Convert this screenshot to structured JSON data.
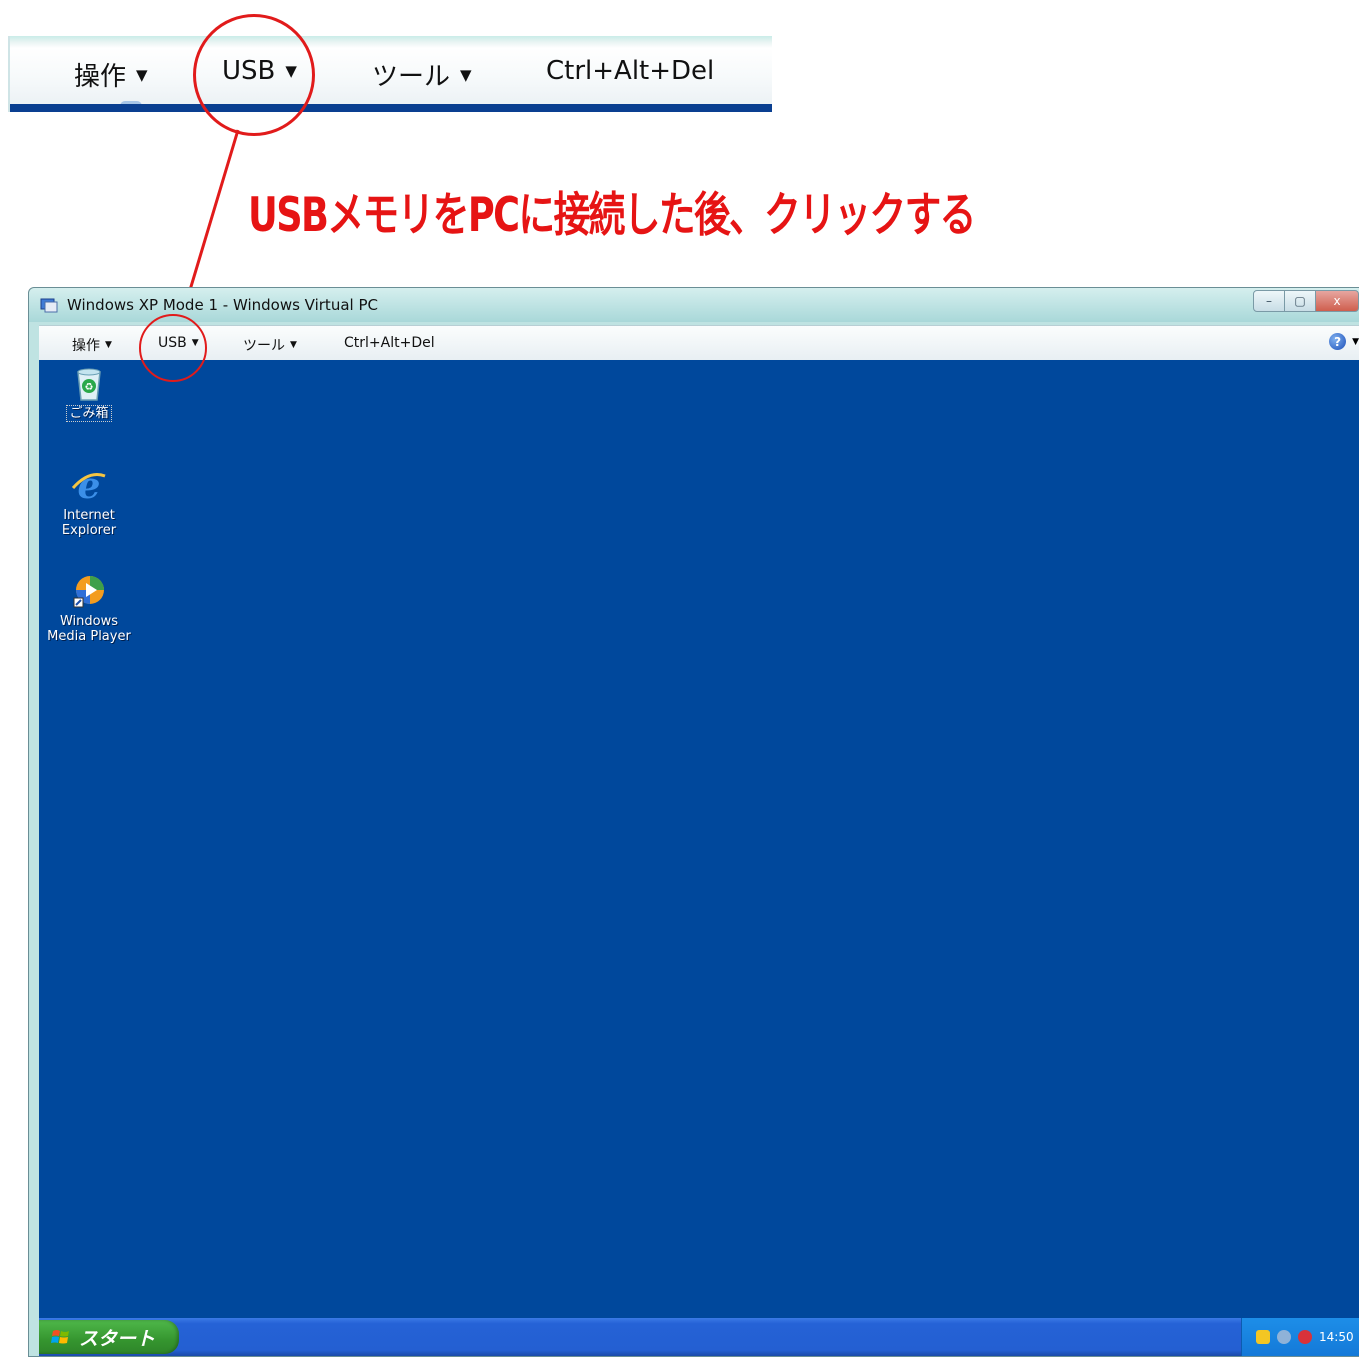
{
  "zoom_toolbar": {
    "menus": [
      {
        "label": "操作"
      },
      {
        "label": "USB"
      },
      {
        "label": "ツール"
      },
      {
        "label": "Ctrl+Alt+Del"
      }
    ]
  },
  "annotation": {
    "text": "USBメモリをPCに接続した後、クリックする",
    "color": "#e61414"
  },
  "window": {
    "title": "Windows XP Mode 1 - Windows Virtual PC",
    "controls": {
      "minimize": "–",
      "maximize": "▢",
      "close": "x"
    },
    "toolbar": {
      "menus": [
        {
          "label": "操作"
        },
        {
          "label": "USB"
        },
        {
          "label": "ツール"
        },
        {
          "label": "Ctrl+Alt+Del"
        }
      ],
      "help_icon": "help-icon"
    }
  },
  "desktop": {
    "background": "#00489c",
    "icons": [
      {
        "label": "ごみ箱",
        "icon": "recycle-bin-icon"
      },
      {
        "label_line1": "Internet",
        "label_line2": "Explorer",
        "icon": "internet-explorer-icon"
      },
      {
        "label_line1": "Windows",
        "label_line2": "Media Player",
        "icon": "media-player-icon"
      }
    ],
    "taskbar": {
      "start_label": "スタート",
      "clock": "14:50"
    }
  }
}
